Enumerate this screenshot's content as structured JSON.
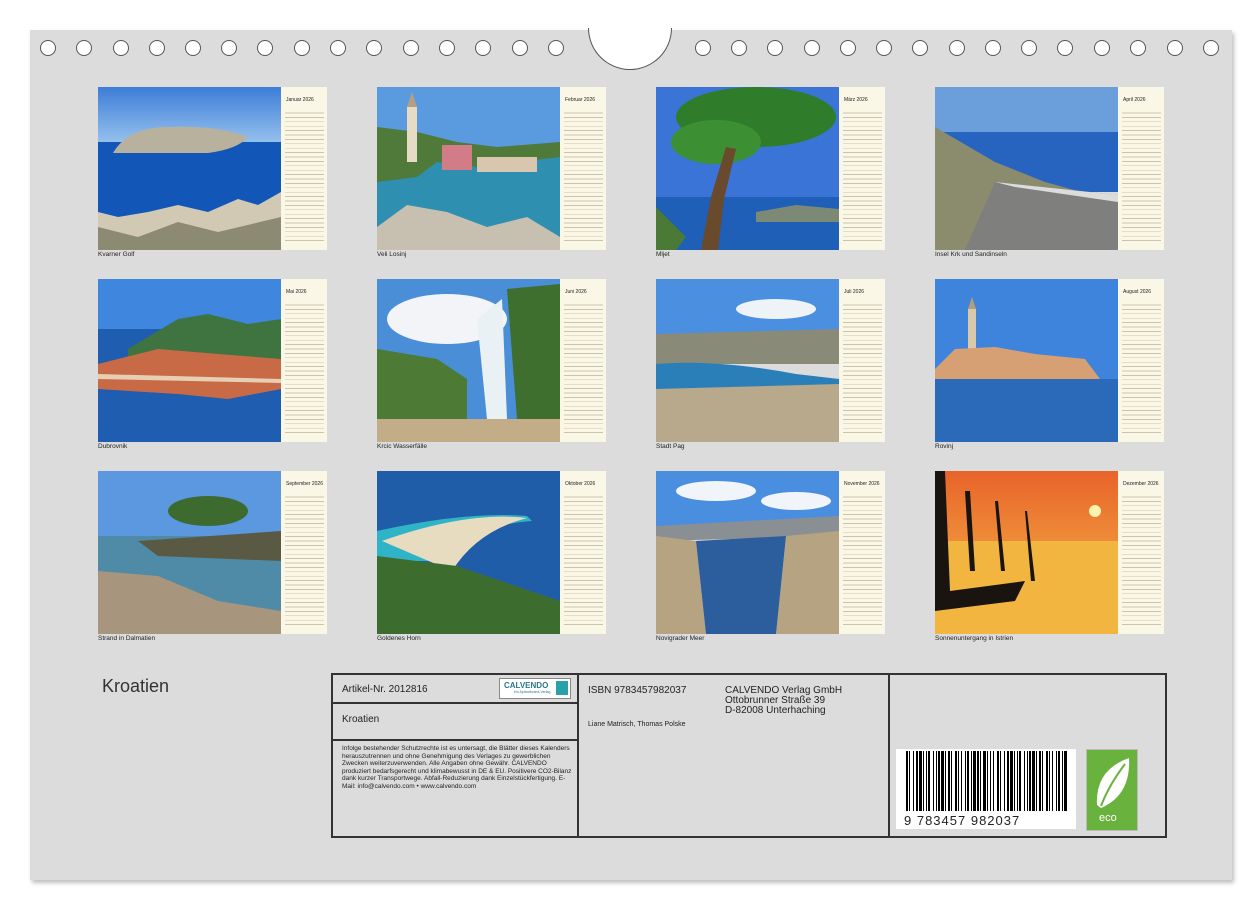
{
  "document": {
    "title": "Kroatien"
  },
  "months": [
    {
      "month": "Januar 2026",
      "caption": "Kvarner Golf"
    },
    {
      "month": "Februar 2026",
      "caption": "Veli Losinj"
    },
    {
      "month": "März 2026",
      "caption": "Mljet"
    },
    {
      "month": "April 2026",
      "caption": "Insel Krk und Sandinseln"
    },
    {
      "month": "Mai 2026",
      "caption": "Dubrovnik"
    },
    {
      "month": "Juni 2026",
      "caption": "Krcic Wasserfälle"
    },
    {
      "month": "Juli 2026",
      "caption": "Stadt Pag"
    },
    {
      "month": "August 2026",
      "caption": "Rovinj"
    },
    {
      "month": "September 2026",
      "caption": "Strand in Dalmatien"
    },
    {
      "month": "Oktober 2026",
      "caption": "Goldenes Horn"
    },
    {
      "month": "November 2026",
      "caption": "Novigrader Meer"
    },
    {
      "month": "Dezember 2026",
      "caption": "Sonnenuntergang in Istrien"
    }
  ],
  "info": {
    "article": "Artikel-Nr. 2012816",
    "logo": "CALVENDO",
    "logo_sub": "ein Apricotbrand-Verlag",
    "title": "Kroatien",
    "legal": "Infolge bestehender Schutzrechte ist es untersagt, die Blätter dieses Kalenders herauszutrennen und ohne Genehmigung des Verlages zu gewerblichen Zwecken weiterzuverwenden. Alle Angaben ohne Gewähr. CALVENDO produziert bedarfsgerecht und klimabewusst in DE & EU. Positivere CO2-Bilanz dank kurzer Transportwege. Abfall-Reduzierung dank Einzelstückfertigung. E-Mail: info@calvendo.com • www.calvendo.com",
    "isbn": "ISBN 9783457982037",
    "publisher_name": "CALVENDO Verlag GmbH",
    "publisher_street": "Ottobrunner Straße 39",
    "publisher_city": "D-82008 Unterhaching",
    "authors": "Liane Matrisch, Thomas Polske",
    "barcode_number": "9 783457 982037",
    "eco_label": "eco"
  },
  "colors": {
    "page_bg": "#dcdcdc",
    "calendar_strip": "#fbf7e6",
    "eco_green": "#6ab23e"
  }
}
